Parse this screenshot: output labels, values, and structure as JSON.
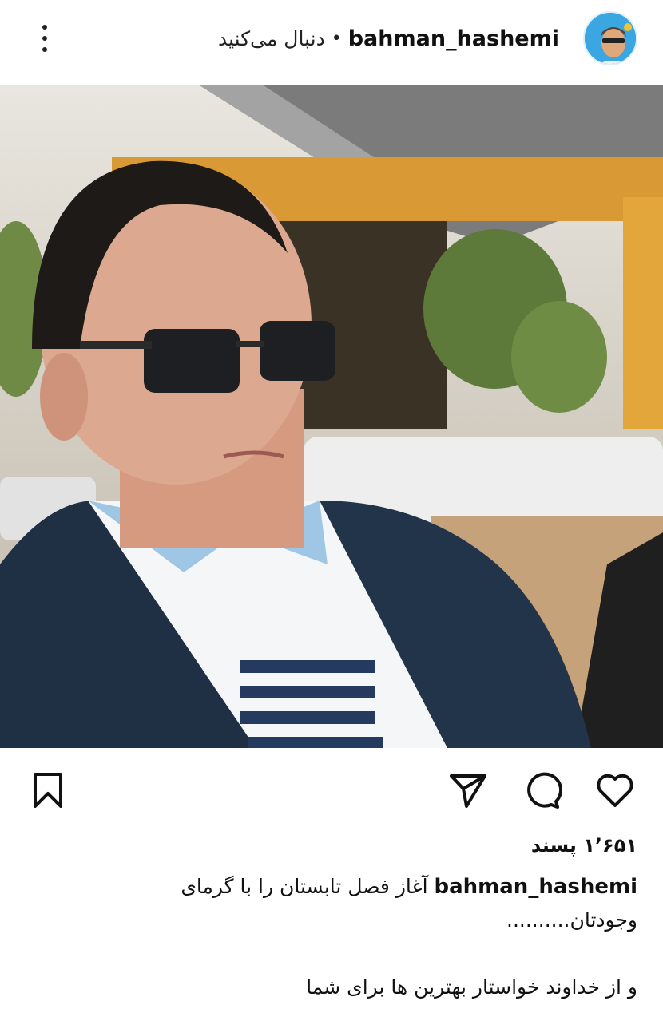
{
  "post": {
    "username": "bahman_hashemi",
    "dot": "•",
    "follow_label": "دنبال می‌کنید",
    "likes": "۱٬۶۵۱ پسند",
    "caption_line1": "آغاز فصل تابستان را با گرمای وجودتان..........",
    "caption_line2": "و از خداوند خواستار بهترین ها  برای شما"
  },
  "icons": {
    "more": "more-vertical-icon",
    "save": "bookmark-icon",
    "share": "send-icon",
    "comment": "comment-icon",
    "like": "heart-icon"
  }
}
